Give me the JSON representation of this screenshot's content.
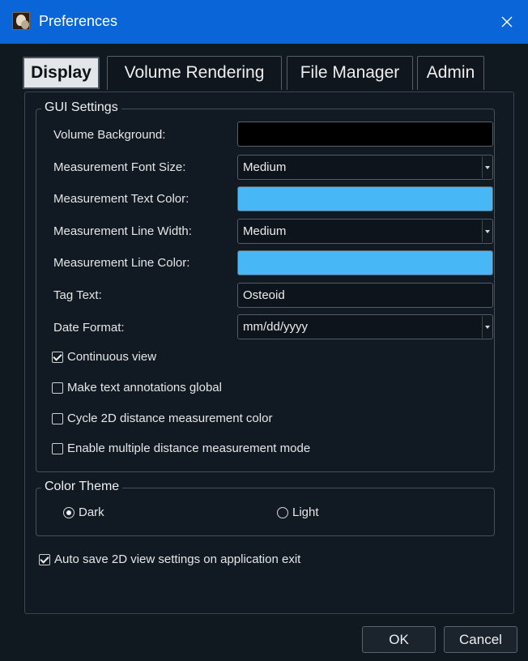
{
  "window": {
    "title": "Preferences",
    "app_icon": "app-logo-icon",
    "close_icon": "close-icon"
  },
  "tabs": [
    {
      "label": "Display",
      "active": true
    },
    {
      "label": "Volume Rendering",
      "active": false
    },
    {
      "label": "File Manager",
      "active": false
    },
    {
      "label": "Admin",
      "active": false
    }
  ],
  "gui_settings": {
    "title": "GUI Settings",
    "volume_background": {
      "label": "Volume Background:",
      "color": "#000000"
    },
    "measurement_font_size": {
      "label": "Measurement Font Size:",
      "value": "Medium"
    },
    "measurement_text_color": {
      "label": "Measurement Text Color:",
      "color": "#47b8f5"
    },
    "measurement_line_width": {
      "label": "Measurement Line Width:",
      "value": "Medium"
    },
    "measurement_line_color": {
      "label": "Measurement Line Color:",
      "color": "#47b8f5"
    },
    "tag_text": {
      "label": "Tag Text:",
      "value": "Osteoid"
    },
    "date_format": {
      "label": "Date Format:",
      "value": "mm/dd/yyyy"
    },
    "checkboxes": [
      {
        "label": "Continuous view",
        "checked": true
      },
      {
        "label": "Make text annotations global",
        "checked": false
      },
      {
        "label": "Cycle 2D distance measurement color",
        "checked": false
      },
      {
        "label": "Enable multiple distance measurement mode",
        "checked": false
      }
    ]
  },
  "color_theme": {
    "title": "Color Theme",
    "options": [
      {
        "label": "Dark",
        "selected": true
      },
      {
        "label": "Light",
        "selected": false
      }
    ]
  },
  "auto_save": {
    "label": "Auto save 2D view settings on application exit",
    "checked": true
  },
  "buttons": {
    "ok": "OK",
    "cancel": "Cancel"
  }
}
